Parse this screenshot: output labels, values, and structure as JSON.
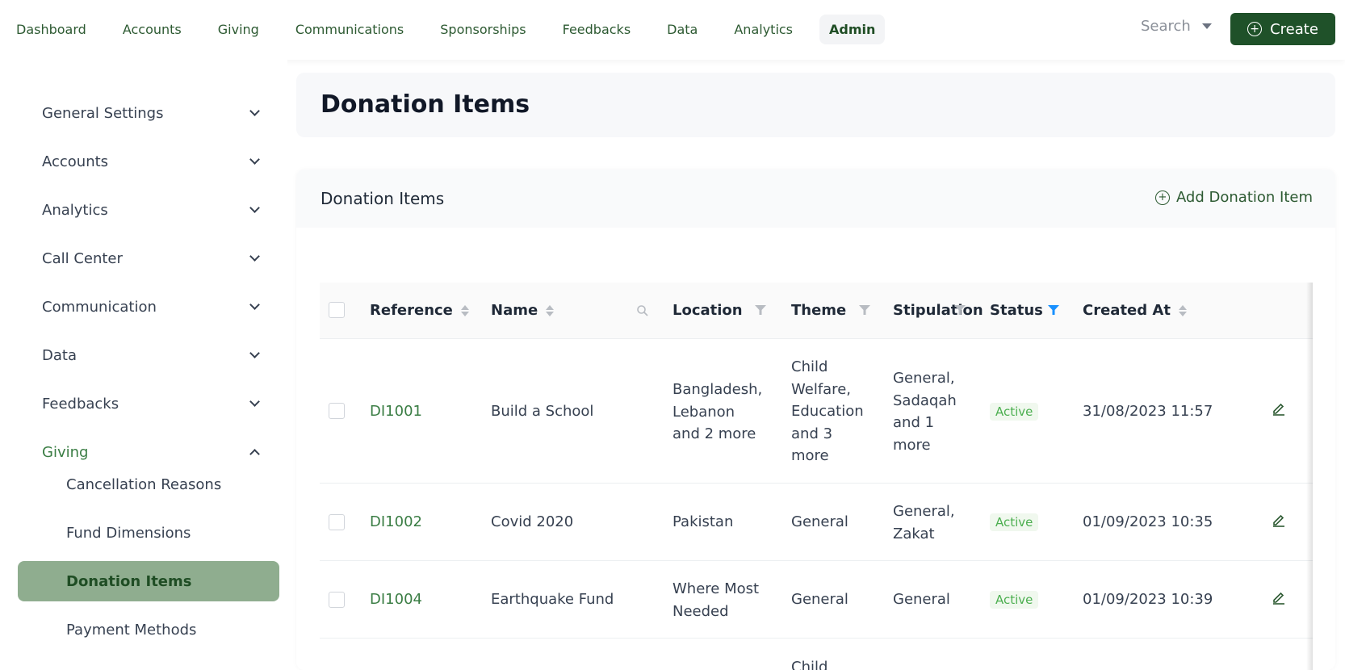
{
  "nav": {
    "items": [
      "Dashboard",
      "Accounts",
      "Giving",
      "Communications",
      "Sponsorships",
      "Feedbacks",
      "Data",
      "Analytics",
      "Admin"
    ],
    "active": "Admin",
    "search_label": "Search",
    "create_label": "Create"
  },
  "sidebar": {
    "sections": [
      {
        "label": "General Settings",
        "expanded": false
      },
      {
        "label": "Accounts",
        "expanded": false
      },
      {
        "label": "Analytics",
        "expanded": false
      },
      {
        "label": "Call Center",
        "expanded": false
      },
      {
        "label": "Communication",
        "expanded": false
      },
      {
        "label": "Data",
        "expanded": false
      },
      {
        "label": "Feedbacks",
        "expanded": false
      },
      {
        "label": "Giving",
        "expanded": true
      }
    ],
    "giving_items": [
      "Cancellation Reasons",
      "Fund Dimensions",
      "Donation Items",
      "Payment Methods"
    ],
    "active_item": "Donation Items"
  },
  "page": {
    "title": "Donation Items"
  },
  "card": {
    "title": "Donation Items",
    "add_label": "Add Donation Item"
  },
  "table": {
    "columns": [
      "Reference",
      "Name",
      "Location",
      "Theme",
      "Stipulation",
      "Status",
      "Created At"
    ],
    "rows": [
      {
        "reference": "DI1001",
        "name": "Build a School",
        "location": [
          "Bangladesh,",
          "Lebanon",
          "and 2 more"
        ],
        "theme": [
          "Child",
          "Welfare,",
          "Education",
          "and 3",
          "more"
        ],
        "stipulation": [
          "General,",
          "Sadaqah",
          "and 1",
          "more"
        ],
        "status": "Active",
        "created_at": "31/08/2023 11:57"
      },
      {
        "reference": "DI1002",
        "name": "Covid 2020",
        "location": [
          "Pakistan"
        ],
        "theme": [
          "General"
        ],
        "stipulation": [
          "General,",
          "Zakat"
        ],
        "status": "Active",
        "created_at": "01/09/2023 10:35"
      },
      {
        "reference": "DI1004",
        "name": "Earthquake Fund",
        "location": [
          "Where Most",
          "Needed"
        ],
        "theme": [
          "General"
        ],
        "stipulation": [
          "General"
        ],
        "status": "Active",
        "created_at": "01/09/2023 10:39"
      }
    ],
    "partial_row_theme": "Child"
  },
  "colors": {
    "brand_dark": "#1f5129",
    "brand_text": "#2d5a32",
    "active_sidebar_bg": "#8fad8f",
    "status_active": "#4caf50",
    "status_filter_active": "#1890ff"
  }
}
